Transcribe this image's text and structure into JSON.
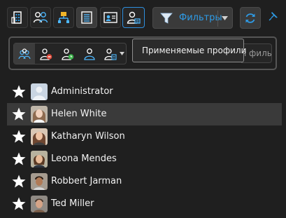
{
  "toolbar": {
    "buttons": [
      {
        "name": "organization"
      },
      {
        "name": "groups"
      },
      {
        "name": "hierarchy"
      },
      {
        "name": "list-view"
      },
      {
        "name": "contact-card"
      },
      {
        "name": "user-profile"
      }
    ],
    "filter_label": "Фильтры"
  },
  "filter_panel": {
    "tooltip": "Применяемые профили",
    "search_placeholder": "я филь"
  },
  "users": [
    {
      "name": "Administrator",
      "favorite": true,
      "selected": false
    },
    {
      "name": "Helen White",
      "favorite": true,
      "selected": true
    },
    {
      "name": "Katharyn Wilson",
      "favorite": true,
      "selected": false
    },
    {
      "name": "Leona Mendes",
      "favorite": true,
      "selected": false
    },
    {
      "name": "Robbert Jarman",
      "favorite": true,
      "selected": false
    },
    {
      "name": "Ted Miller",
      "favorite": true,
      "selected": false
    }
  ],
  "colors": {
    "accent": "#2e9be6",
    "background": "#1f1f1f",
    "selected_row": "#3a3a3a"
  }
}
